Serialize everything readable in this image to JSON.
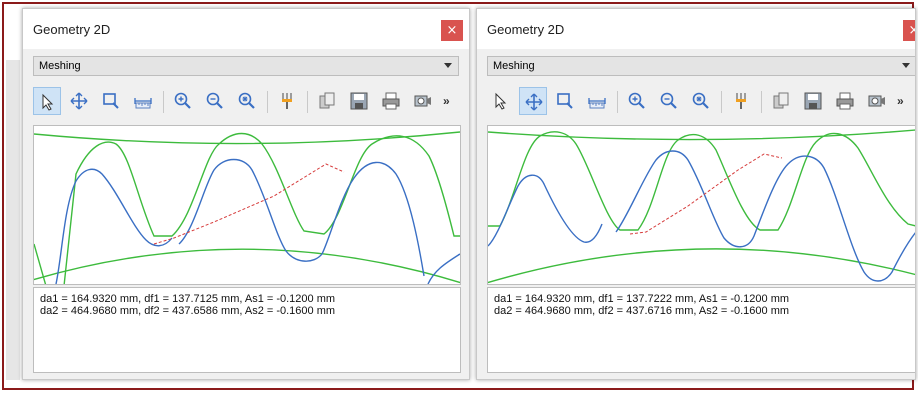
{
  "panels": [
    {
      "title": "Geometry 2D",
      "close_symbol": "×",
      "view_select": "Meshing",
      "toolbar_more": "»",
      "info_lines": [
        "da1 = 164.9320 mm, df1 = 137.7125 mm, As1 = -0.1200 mm",
        "da2 = 464.9680 mm, df2 = 437.6586 mm, As2 = -0.1600 mm"
      ],
      "active_tool": "select-tool"
    },
    {
      "title": "Geometry 2D",
      "close_symbol": "×",
      "view_select": "Meshing",
      "toolbar_more": "»",
      "info_lines": [
        "da1 = 164.9320 mm, df1 = 137.7222 mm, As1 = -0.1200 mm",
        "da2 = 464.9680 mm, df2 = 437.6716 mm, As2 = -0.1600 mm"
      ],
      "active_tool": "pan-tool"
    }
  ],
  "colors": {
    "frame_border": "#8b1a1a",
    "close_button": "#d9534f",
    "gear1_profile": "#3a6fc4",
    "gear2_profile": "#3dbb3d",
    "path_of_contact": "#d63b3b"
  },
  "toolbar_icons": [
    "select-tool",
    "pan-tool",
    "zoom-window-tool",
    "measure-tool",
    "zoom-in-tool",
    "zoom-out-tool",
    "zoom-fit-tool",
    "pin-tool",
    "copy-tool",
    "save-tool",
    "print-tool",
    "camera-tool"
  ]
}
